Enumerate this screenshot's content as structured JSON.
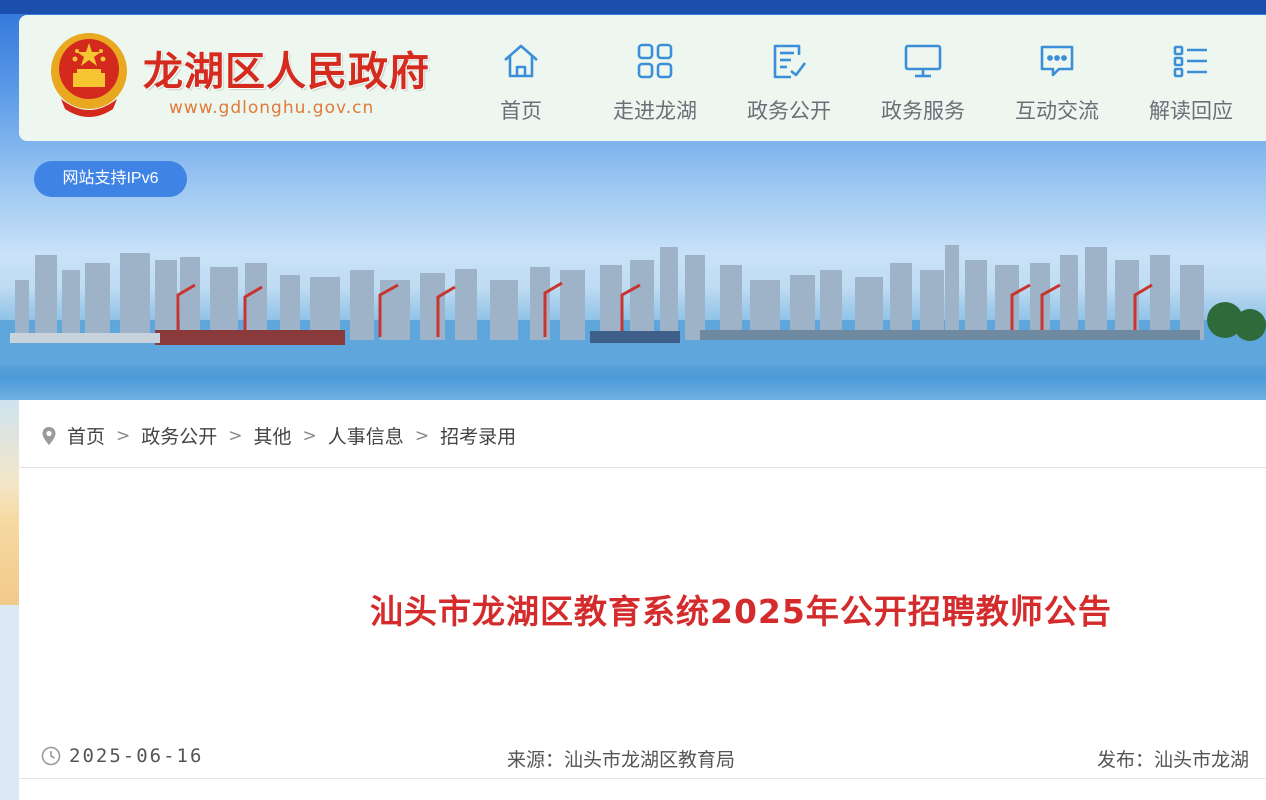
{
  "header": {
    "site_title": "龙湖区人民政府",
    "site_url": "www.gdlonghu.gov.cn"
  },
  "nav": {
    "items": [
      {
        "label": "首页",
        "icon": "home-icon"
      },
      {
        "label": "走进龙湖",
        "icon": "grid-icon"
      },
      {
        "label": "政务公开",
        "icon": "document-edit-icon"
      },
      {
        "label": "政务服务",
        "icon": "monitor-icon"
      },
      {
        "label": "互动交流",
        "icon": "chat-bubble-icon"
      },
      {
        "label": "解读回应",
        "icon": "list-icon"
      }
    ]
  },
  "banner": {
    "ipv6_badge": "网站支持IPv6"
  },
  "breadcrumb": {
    "items": [
      "首页",
      "政务公开",
      "其他",
      "人事信息",
      "招考录用"
    ],
    "separator": ">"
  },
  "article": {
    "title": "汕头市龙湖区教育系统2025年公开招聘教师公告",
    "date": "2025-06-16",
    "source": "来源：汕头市龙湖区教育局",
    "publisher": "发布：汕头市龙湖"
  },
  "colors": {
    "title_red": "#d42c2c",
    "brand_red": "#d52a1e",
    "nav_icon_blue": "#3a8fd8",
    "ipv6_blue": "#3f84e5"
  }
}
